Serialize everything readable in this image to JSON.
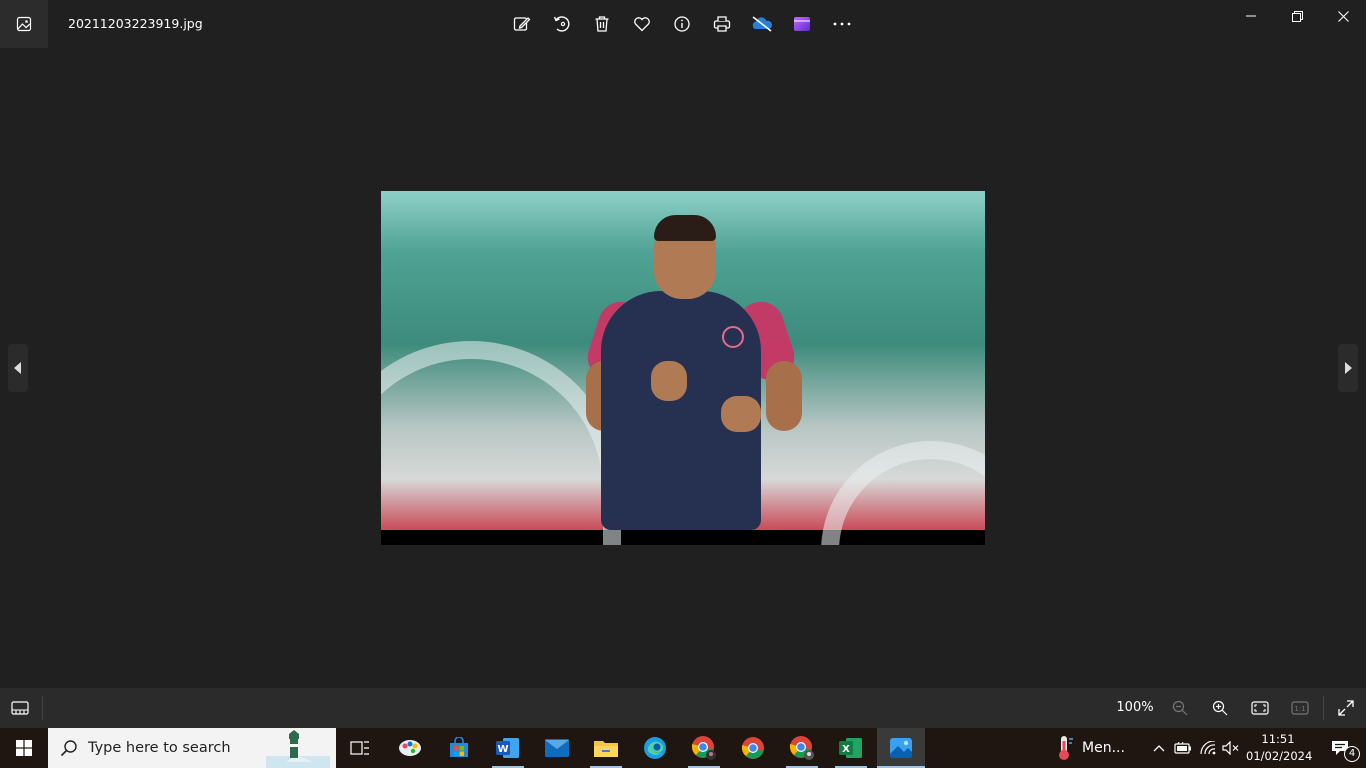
{
  "window": {
    "filename": "20211203223919.jpg"
  },
  "toolbar": {
    "buttons": [
      "edit-image-icon",
      "rotate-icon",
      "delete-icon",
      "favorite-icon",
      "info-icon",
      "print-icon",
      "onedrive-icon",
      "clipchamp-icon",
      "more-icon"
    ]
  },
  "window_controls": [
    "minimize",
    "restore",
    "close"
  ],
  "image": {
    "alt": "Man in navy and pink training shirt jogging in a stadium"
  },
  "bottombar": {
    "zoom": "100%",
    "zoom_level": 100
  },
  "taskbar": {
    "search_placeholder": "Type here to search",
    "apps": [
      "task-view",
      "paint-3d",
      "microsoft-store",
      "word",
      "mail",
      "file-explorer",
      "edge",
      "chrome-profile-1",
      "chrome",
      "chrome-profile-2",
      "excel",
      "photos"
    ],
    "weather_text": "Men...",
    "time": "11:51",
    "date": "01/02/2024",
    "notification_count": "4"
  },
  "colors": {
    "background": "#202020",
    "bar": "#2b2b2b",
    "taskbar": "#1f1612",
    "accent": "#9ec3e6"
  }
}
